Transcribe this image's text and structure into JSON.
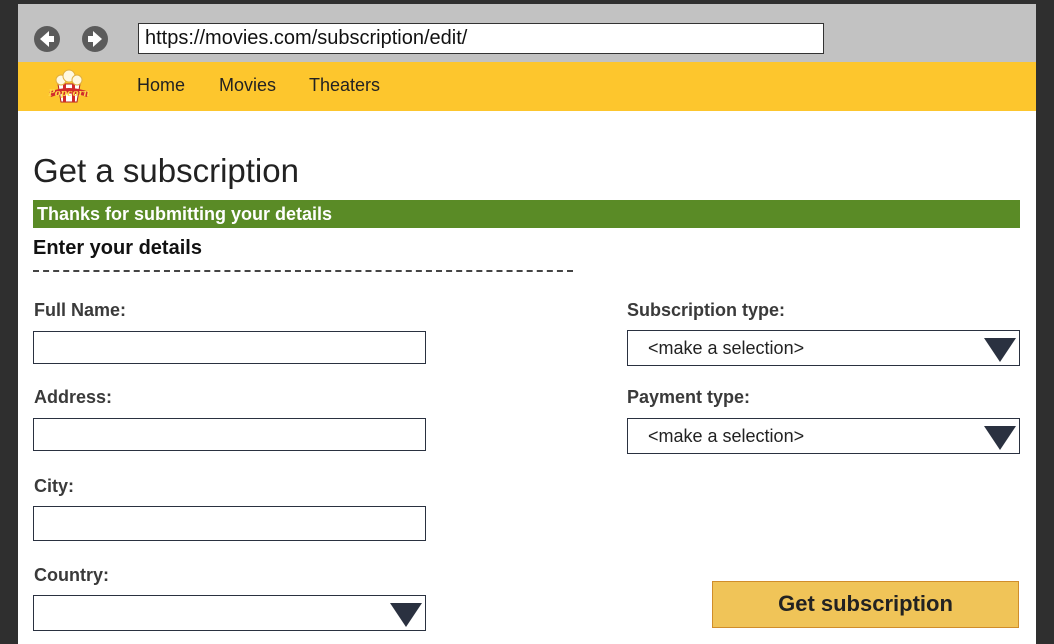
{
  "browser": {
    "url": "https://movies.com/subscription/edit/",
    "back_icon": "back-arrow-icon",
    "forward_icon": "forward-arrow-icon"
  },
  "navbar": {
    "logo_text": "Popcorn",
    "links": [
      "Home",
      "Movies",
      "Theaters"
    ],
    "color": "#fdc62d"
  },
  "page": {
    "title": "Get a subscription",
    "banner": "Thanks for submitting your details",
    "banner_color": "#5a8b26",
    "section_heading": "Enter your details"
  },
  "form": {
    "full_name_label": "Full Name:",
    "address_label": "Address:",
    "city_label": "City:",
    "country_label": "Country:",
    "subscription_type_label": "Subscription type:",
    "subscription_type_value": "<make a selection>",
    "payment_type_label": "Payment type:",
    "payment_type_value": "<make a selection>",
    "submit_label": "Get subscription",
    "submit_color": "#f0c458"
  }
}
